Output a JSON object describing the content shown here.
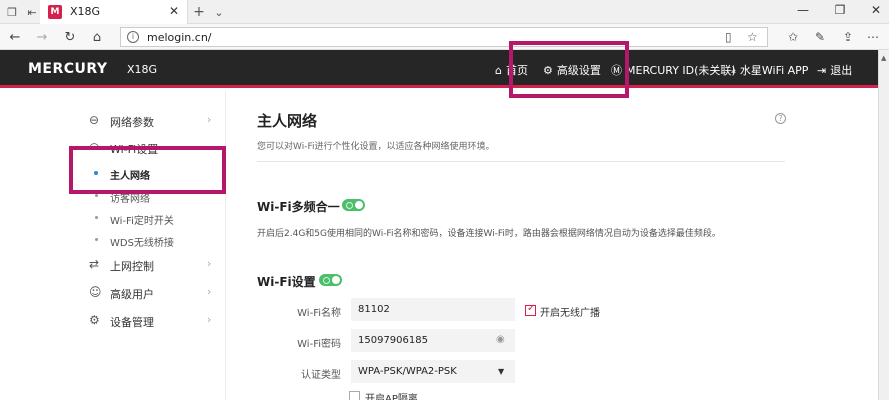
{
  "browser": {
    "tab_title": "X18G",
    "tab_favicon": "M",
    "url": "melogin.cn/"
  },
  "header": {
    "logo": "MERCURY",
    "model": "X18G",
    "nav": [
      {
        "icon": "home-icon",
        "glyph": "⌂",
        "label": "首页"
      },
      {
        "icon": "gear-icon",
        "glyph": "⚙",
        "label": "高级设置"
      },
      {
        "icon": "mercury-id-icon",
        "glyph": "Ⓜ",
        "label": "MERCURY ID(未关联)"
      },
      {
        "icon": "download-icon",
        "glyph": "⤓",
        "label": "水星WiFi APP"
      },
      {
        "icon": "logout-icon",
        "glyph": "⇥",
        "label": "退出"
      }
    ]
  },
  "sidebar": {
    "items": [
      {
        "label": "网络参数",
        "glyph": "⊖"
      },
      {
        "label": "Wi-Fi设置",
        "glyph": "◠"
      },
      {
        "label": "上网控制",
        "glyph": "⇄"
      },
      {
        "label": "高级用户",
        "glyph": "☺"
      },
      {
        "label": "设备管理",
        "glyph": "⚙"
      }
    ],
    "wifi_sub": [
      {
        "label": "主人网络",
        "active": true
      },
      {
        "label": "访客网络",
        "active": false
      },
      {
        "label": "Wi-Fi定时开关",
        "active": false
      },
      {
        "label": "WDS无线桥接",
        "active": false
      }
    ]
  },
  "main": {
    "title": "主人网络",
    "description": "您可以对Wi-Fi进行个性化设置，以适应各种网络使用环境。",
    "multiband": {
      "title": "Wi-Fi多频合一",
      "enabled": true,
      "description": "开启后2.4G和5G使用相同的Wi-Fi名称和密码，设备连接Wi-Fi时，路由器会根据网络情况自动为设备选择最佳频段。"
    },
    "wifi": {
      "title": "Wi-Fi设置",
      "enabled": true,
      "name_label": "Wi-Fi名称",
      "name_value": "81102",
      "broadcast_label": "开启无线广播",
      "broadcast_checked": true,
      "password_label": "Wi-Fi密码",
      "password_value": "15097906185",
      "auth_label": "认证类型",
      "auth_value": "WPA-PSK/WPA2-PSK",
      "ap_isolation_label": "开启AP隔离",
      "ap_isolation_checked": false
    }
  },
  "colors": {
    "accent": "#d6204d",
    "header_bg": "#262626",
    "toggle_on": "#4cbf6a",
    "highlight": "#b5186b"
  }
}
